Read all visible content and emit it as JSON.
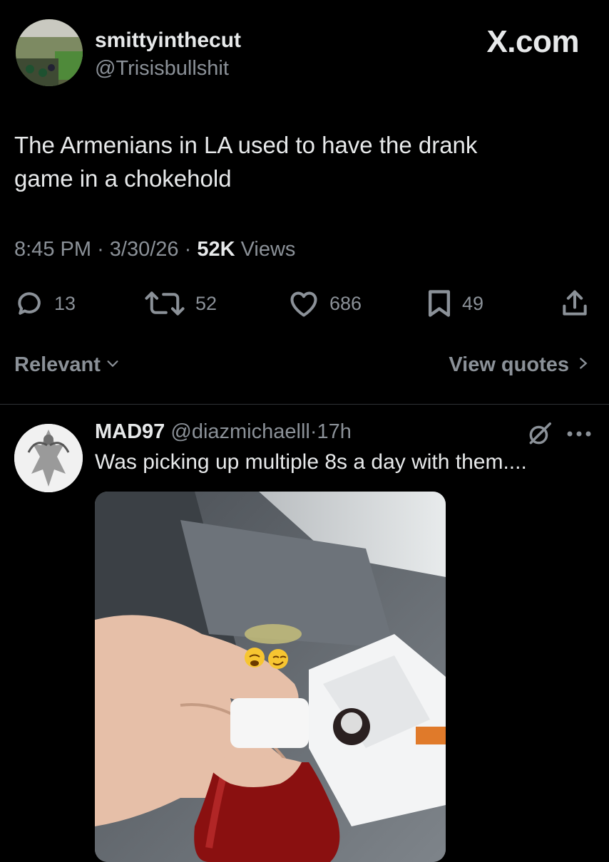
{
  "post": {
    "author_name": "smittyinthecut",
    "author_handle": "@Trisisbullshit",
    "text_line1": "The Armenians in LA used to have the drank",
    "text_line2": "game in a chokehold",
    "time": "8:45 PM",
    "date": "3/30/26",
    "views_count": "52K",
    "views_label": "Views",
    "replies": "13",
    "reposts": "52",
    "likes": "686",
    "bookmarks": "49"
  },
  "brand": {
    "label": "X.com"
  },
  "filter": {
    "label": "Relevant"
  },
  "quotes": {
    "label": "View quotes"
  },
  "reply": {
    "author_name": "MAD97",
    "author_handle": "@diazmichaelll",
    "age": "17h",
    "text": "Was picking up multiple 8s a day with them....",
    "media_emojis": "😩😏"
  },
  "icons": {
    "reply": "reply-icon",
    "repost": "repost-icon",
    "like": "heart-icon",
    "bookmark": "bookmark-icon",
    "share": "share-icon",
    "relevant_chevron": "chevron-down-icon",
    "quotes_chevron": "chevron-right-icon",
    "grok": "grok-icon",
    "more": "more-icon"
  },
  "colors": {
    "background": "#000000",
    "text": "#e7e9ea",
    "secondary": "#8b9198",
    "divider": "#2f3336"
  }
}
